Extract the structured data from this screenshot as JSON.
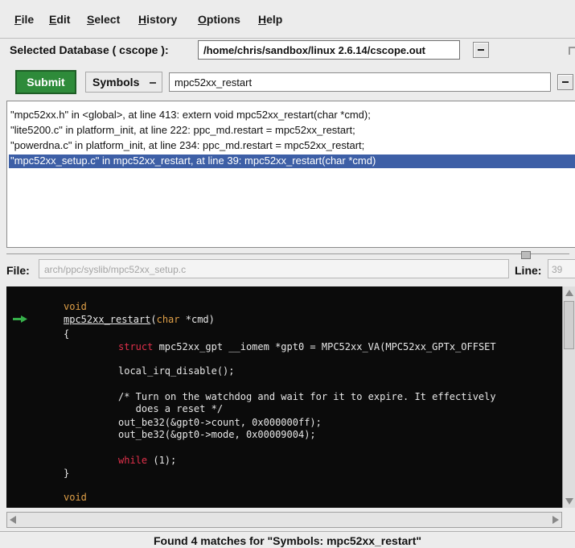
{
  "menu": {
    "items": [
      {
        "mnemonic": "F",
        "rest": "ile"
      },
      {
        "mnemonic": "E",
        "rest": "dit"
      },
      {
        "mnemonic": "S",
        "rest": "elect"
      },
      {
        "mnemonic": "H",
        "rest": "istory"
      },
      {
        "mnemonic": "O",
        "rest": "ptions"
      },
      {
        "mnemonic": "H",
        "rest": "elp"
      }
    ]
  },
  "database": {
    "label": "Selected Database ( cscope ):",
    "value": "/home/chris/sandbox/linux 2.6.14/cscope.out"
  },
  "query": {
    "submit_label": "Submit",
    "type_label": "Symbols",
    "value": "mpc52xx_restart"
  },
  "results": [
    "\"mpc52xx.h\" in <global>, at line 413: extern void mpc52xx_restart(char *cmd);",
    "\"lite5200.c\" in platform_init, at line 222: ppc_md.restart = mpc52xx_restart;",
    "\"powerdna.c\" in platform_init, at line 234: ppc_md.restart = mpc52xx_restart;",
    "\"mpc52xx_setup.c\" in mpc52xx_restart, at line 39: mpc52xx_restart(char *cmd)"
  ],
  "selected_result_index": 3,
  "file": {
    "label": "File:",
    "value": "arch/ppc/syslib/mpc52xx_setup.c",
    "line_label": "Line:",
    "line_value": "39"
  },
  "code": {
    "kw_void_1": "void",
    "fn_name": "mpc52xx_restart",
    "fn_paren": "(",
    "fn_char": "char",
    "fn_rest": " *cmd)",
    "brace_open": "{",
    "struct_kw": "struct",
    "struct_rest": " mpc52xx_gpt __iomem *gpt0 = MPC52xx_VA(MPC52xx_GPTx_OFFSET",
    "irq_line": "local_irq_disable();",
    "comment_1": "/* Turn on the watchdog and wait for it to expire. It effectively",
    "comment_2": "   does a reset */",
    "out_1": "out_be32(&gpt0->count, 0x000000ff);",
    "out_2": "out_be32(&gpt0->mode, 0x00009004);",
    "while_kw": "while",
    "while_rest": " (1);",
    "brace_close": "}",
    "kw_void_2": "void"
  },
  "status": "Found 4 matches for \"Symbols: mpc52xx_restart\"",
  "colors": {
    "submit": "#2e8b3a",
    "selection": "#3d5fa6",
    "code_bg": "#0b0b0b",
    "keyword": "#e0a048",
    "keyword_red": "#e0304a",
    "marker": "#36b04a"
  },
  "icons": {
    "current_line_marker": "green-arrow-icon"
  }
}
